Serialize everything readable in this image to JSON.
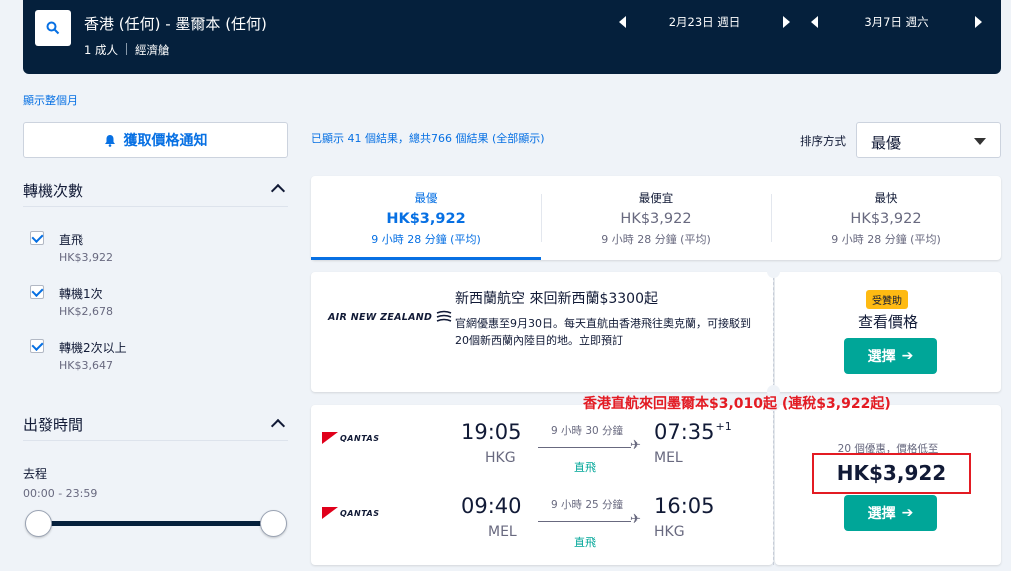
{
  "header": {
    "route": "香港 (任何) - 墨爾本 (任何)",
    "passengers": "1 成人",
    "cabin": "經濟艙",
    "depart_date": "2月23日 週日",
    "return_date": "3月7日 週六"
  },
  "sidebar": {
    "show_month": "顯示整個月",
    "price_alert": "獲取價格通知",
    "stops_heading": "轉機次數",
    "stops": [
      {
        "label": "直飛",
        "price": "HK$3,922"
      },
      {
        "label": "轉機1次",
        "price": "HK$2,678"
      },
      {
        "label": "轉機2次以上",
        "price": "HK$3,647"
      }
    ],
    "depart_time_heading": "出發時間",
    "outbound_label": "去程",
    "outbound_range": "00:00 - 23:59"
  },
  "results": {
    "count_text": "已顯示 41 個結果，總共766 個結果 (全部顯示)",
    "sort_label": "排序方式",
    "sort_value": "最優"
  },
  "tabs": [
    {
      "title": "最優",
      "price": "HK$3,922",
      "duration": "9 小時 28 分鐘 (平均)"
    },
    {
      "title": "最便宜",
      "price": "HK$3,922",
      "duration": "9 小時 28 分鐘 (平均)"
    },
    {
      "title": "最快",
      "price": "HK$3,922",
      "duration": "9 小時 28 分鐘 (平均)"
    }
  ],
  "ad": {
    "logo_text": "AIR NEW ZEALAND",
    "title": "新西蘭航空 來回新西蘭$3300起",
    "description": "官網優惠至9月30日。每天直航由香港飛往奧克蘭，可接駁到20個新西蘭內陸目的地。立即預訂",
    "sponsored": "受贊助",
    "view_price": "查看價格",
    "select": "選擇"
  },
  "promo": "香港直航來回墨爾本$3,010起 (連稅$3,922起)",
  "flight": {
    "airline": "QANTAS",
    "outbound": {
      "dep_time": "19:05",
      "dep_code": "HKG",
      "duration": "9 小時 30 分鐘",
      "stops": "直飛",
      "arr_time": "07:35",
      "arr_offset": "+1",
      "arr_code": "MEL"
    },
    "inbound": {
      "dep_time": "09:40",
      "dep_code": "MEL",
      "duration": "9 小時 25 分鐘",
      "stops": "直飛",
      "arr_time": "16:05",
      "arr_code": "HKG"
    },
    "offers_note": "20 個優惠，價格低至",
    "price": "HK$3,922",
    "select": "選擇"
  }
}
